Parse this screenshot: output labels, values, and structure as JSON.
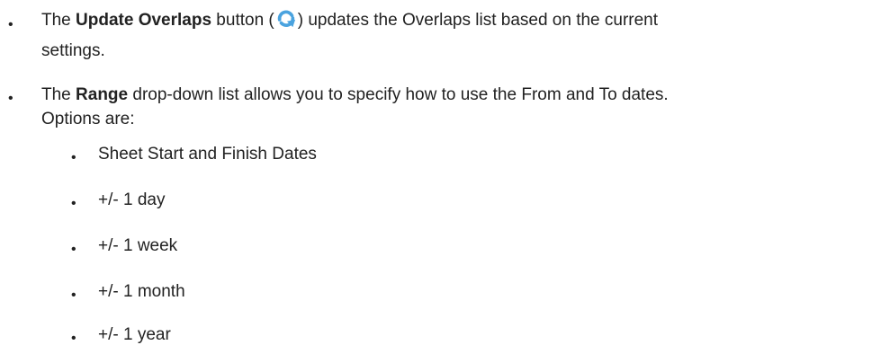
{
  "items": [
    {
      "bold": "Update Overlaps",
      "before": "The ",
      "after_bold": " button (",
      "after_icon": ") updates the Overlaps list based on the current",
      "line2": "settings.",
      "icon": "refresh-arrow-icon",
      "icon_color": "#4aa3df"
    },
    {
      "before": "The ",
      "bold": "Range",
      "after_bold": " drop-down list allows you to specify how to use the From and To dates.",
      "line2": "Options are:"
    }
  ],
  "options": [
    "Sheet Start and Finish Dates",
    "+/- 1 day",
    "+/- 1 week",
    "+/- 1 month",
    "+/- 1 year"
  ]
}
